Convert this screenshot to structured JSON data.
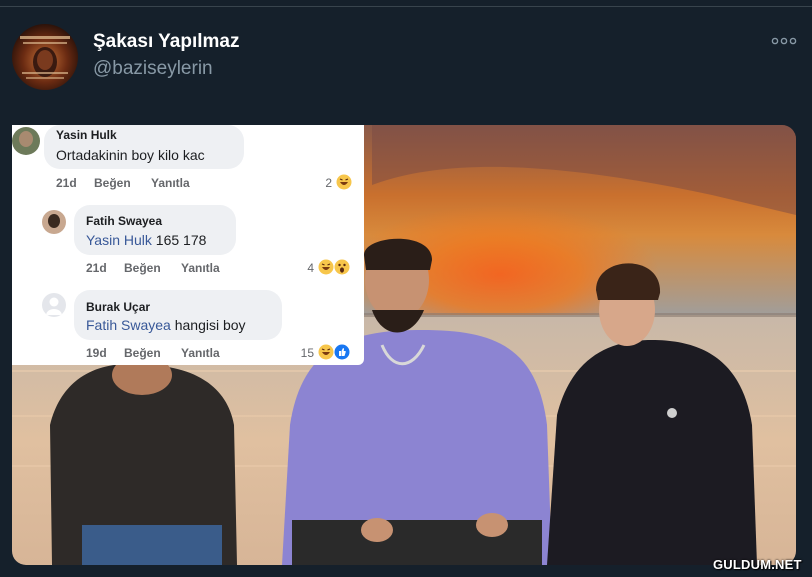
{
  "tweet": {
    "display_name": "Şakası Yapılmaz",
    "handle": "@baziseylerin",
    "avatar_text": [
      "BİRÇOK KİŞİ BENDE",
      "BAZEN ÖLÜMSÜZ OLDUM",
      "BANA BAK HER GÜN",
      "YENİ YAKLAŞIRIM"
    ],
    "more_icon": "ellipsis-icon"
  },
  "comments": [
    {
      "name": "Yasin Hulk",
      "text": "Ortadakinin boy kilo kac",
      "mention": "",
      "time": "21d",
      "like": "Beğen",
      "reply": "Yanıtla",
      "reaction_count": "2",
      "reactions": [
        "laughing-emoji"
      ]
    },
    {
      "name": "Fatih Swayea",
      "mention": "Yasin Hulk",
      "text": " 165 178",
      "time": "21d",
      "like": "Beğen",
      "reply": "Yanıtla",
      "reaction_count": "4",
      "reactions": [
        "laughing-emoji",
        "wow-emoji"
      ]
    },
    {
      "name": "Burak Uçar",
      "mention": "Fatih Swayea",
      "text": " hangisi boy",
      "time": "19d",
      "like": "Beğen",
      "reply": "Yanıtla",
      "reaction_count": "15",
      "reactions": [
        "laughing-emoji",
        "like-emoji"
      ]
    }
  ],
  "watermark": "GULDUM.NET",
  "colors": {
    "background": "#15202b",
    "text_primary": "#ffffff",
    "text_secondary": "#8899a6",
    "mention": "#385898",
    "sunset": "#f08a2c"
  }
}
